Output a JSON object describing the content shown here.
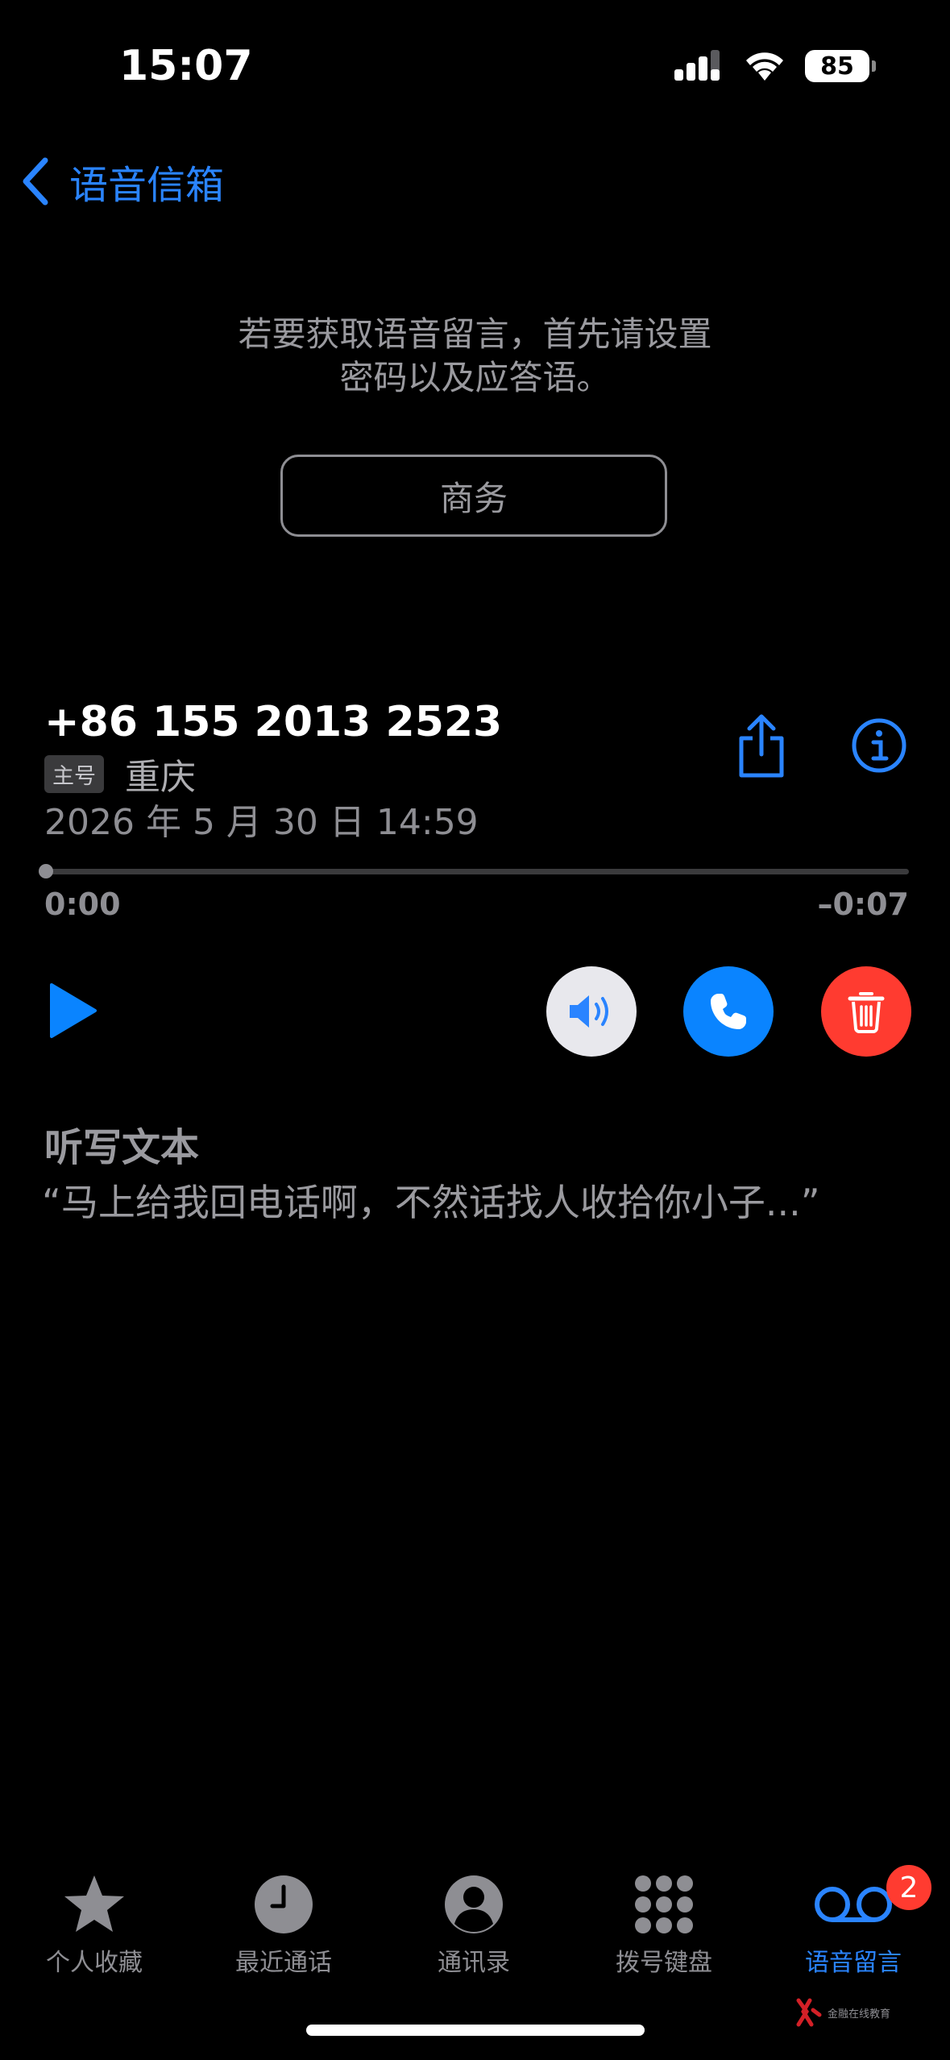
{
  "status_bar": {
    "time": "15:07",
    "battery": "85"
  },
  "nav": {
    "back_label": "语音信箱"
  },
  "setup": {
    "prompt_line1": "若要获取语音留言，首先请设置",
    "prompt_line2": "密码以及应答语。",
    "button_label": "商务"
  },
  "message": {
    "phone": "+86 155 2013 2523",
    "tag": "主号",
    "location": "重庆",
    "datetime": "2026 年 5 月 30 日 14:59",
    "elapsed": "0:00",
    "remaining": "–0:07",
    "progress": 0
  },
  "transcript": {
    "title": "听写文本",
    "text": "“马上给我回电话啊，不然话找人收拾你小子...”"
  },
  "tabs": [
    {
      "label": "个人收藏",
      "icon": "star-icon"
    },
    {
      "label": "最近通话",
      "icon": "clock-icon"
    },
    {
      "label": "通讯录",
      "icon": "contact-icon"
    },
    {
      "label": "拨号键盘",
      "icon": "keypad-icon"
    },
    {
      "label": "语音留言",
      "icon": "voicemail-icon",
      "active": true
    }
  ],
  "badge": "2",
  "watermark": "金融在线教育",
  "colors": {
    "accent": "#0a84ff",
    "danger": "#ff3b30",
    "muted": "#8e8e93"
  }
}
